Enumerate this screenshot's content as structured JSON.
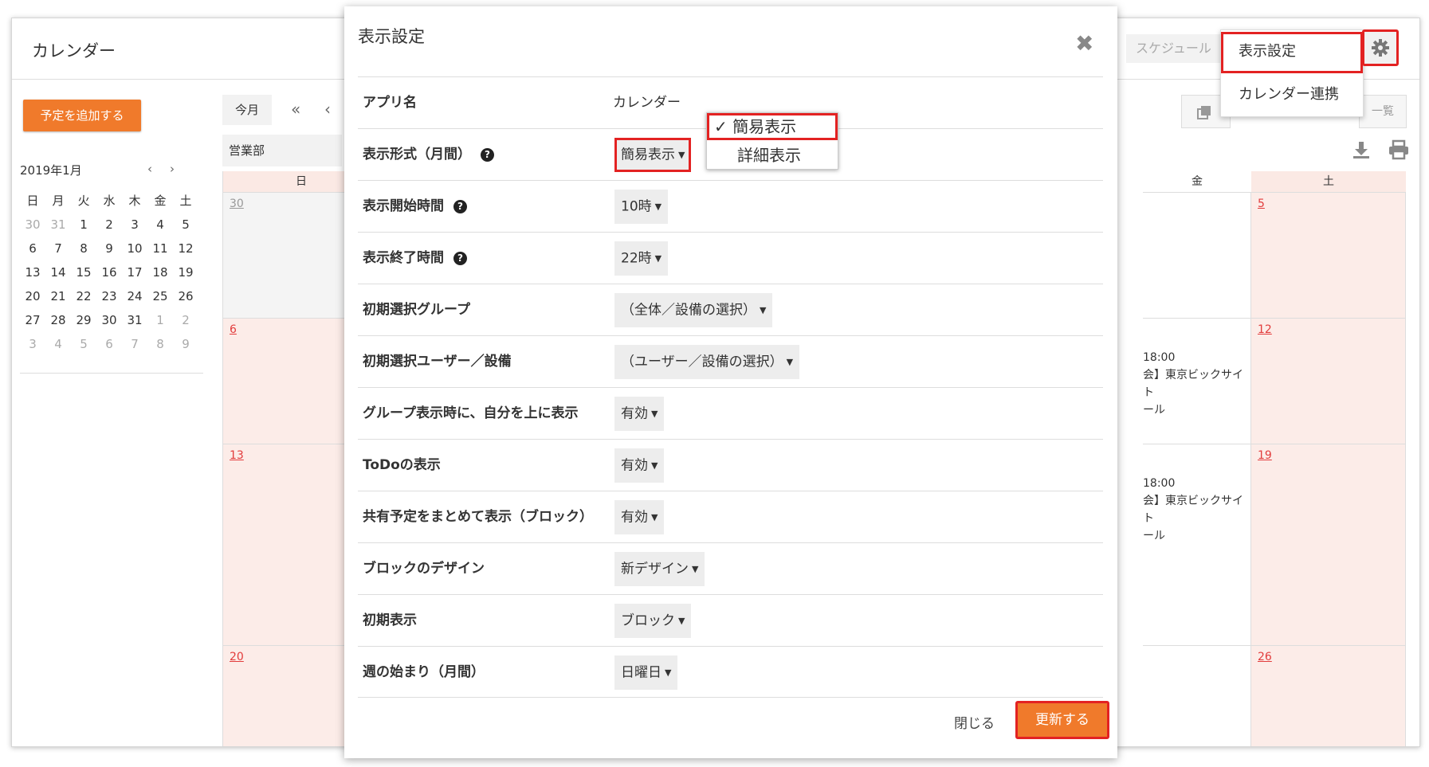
{
  "app": {
    "title": "カレンダー",
    "search_placeholder": "スケジュール",
    "add_button": "予定を追加する",
    "today_button": "今月",
    "group_select": "営業部",
    "list_button": "一覧"
  },
  "settings_menu": {
    "items": [
      "表示設定",
      "カレンダー連携"
    ]
  },
  "mini_calendar": {
    "month": "2019年1月",
    "weekdays": [
      "日",
      "月",
      "火",
      "水",
      "木",
      "金",
      "土"
    ],
    "weeks": [
      [
        "30",
        "31",
        "1",
        "2",
        "3",
        "4",
        "5"
      ],
      [
        "6",
        "7",
        "8",
        "9",
        "10",
        "11",
        "12"
      ],
      [
        "13",
        "14",
        "15",
        "16",
        "17",
        "18",
        "19"
      ],
      [
        "20",
        "21",
        "22",
        "23",
        "24",
        "25",
        "26"
      ],
      [
        "27",
        "28",
        "29",
        "30",
        "31",
        "1",
        "2"
      ],
      [
        "3",
        "4",
        "5",
        "6",
        "7",
        "8",
        "9"
      ]
    ]
  },
  "calendar": {
    "headers": {
      "sun": "日",
      "fri": "金",
      "sat": "土"
    },
    "sun_days": [
      "30",
      "6",
      "13",
      "20"
    ],
    "sat_days": [
      "5",
      "12",
      "19",
      "26"
    ],
    "events": [
      {
        "time": "18:00",
        "line1": "会】東京ビックサイト",
        "line2": "ール"
      },
      {
        "time": "18:00",
        "line1": "会】東京ビックサイト",
        "line2": "ール"
      }
    ]
  },
  "modal": {
    "title": "表示設定",
    "rows": [
      {
        "label": "アプリ名",
        "value": "カレンダー"
      },
      {
        "label": "表示形式（月間）",
        "value": "簡易表示"
      },
      {
        "label": "表示開始時間",
        "value": "10時"
      },
      {
        "label": "表示終了時間",
        "value": "22時"
      },
      {
        "label": "初期選択グループ",
        "value": "（全体／設備の選択）"
      },
      {
        "label": "初期選択ユーザー／設備",
        "value": "（ユーザー／設備の選択）"
      },
      {
        "label": "グループ表示時に、自分を上に表示",
        "value": "有効"
      },
      {
        "label": "ToDoの表示",
        "value": "有効"
      },
      {
        "label": "共有予定をまとめて表示（ブロック）",
        "value": "有効"
      },
      {
        "label": "ブロックのデザイン",
        "value": "新デザイン"
      },
      {
        "label": "初期表示",
        "value": "ブロック"
      },
      {
        "label": "週の始まり（月間）",
        "value": "日曜日"
      }
    ],
    "dropdown_options": [
      "簡易表示",
      "詳細表示"
    ],
    "close_label": "閉じる",
    "update_label": "更新する"
  },
  "colors": {
    "accent": "#f07a2b",
    "highlight": "#e32222",
    "weekend_bg": "#fcece8"
  }
}
